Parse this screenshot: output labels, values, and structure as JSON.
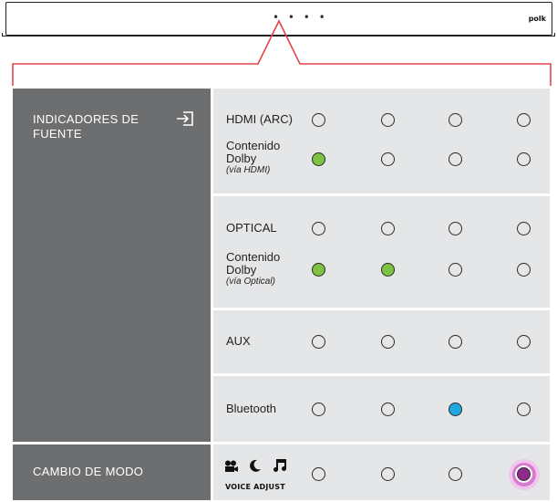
{
  "soundbar": {
    "brand": "polk",
    "indicator_dots": "• • • •"
  },
  "source_indicators": {
    "title": "INDICADORES DE FUENTE",
    "icon": "input-arrow-icon",
    "rows": [
      {
        "id": "hdmi-arc",
        "label": "HDMI (ARC)",
        "sub": "",
        "leds": [
          "off",
          "off",
          "off",
          "off"
        ]
      },
      {
        "id": "dolby-hdmi",
        "label": "Contenido Dolby",
        "sub": "(vía HDMI)",
        "leds": [
          "green",
          "off",
          "off",
          "off"
        ]
      },
      {
        "id": "optical",
        "label": "OPTICAL",
        "sub": "",
        "leds": [
          "off",
          "off",
          "off",
          "off"
        ]
      },
      {
        "id": "dolby-optical",
        "label": "Contenido Dolby",
        "sub": "(vía Optical)",
        "leds": [
          "green",
          "green",
          "off",
          "off"
        ]
      },
      {
        "id": "aux",
        "label": "AUX",
        "sub": "",
        "leds": [
          "off",
          "off",
          "off",
          "off"
        ]
      },
      {
        "id": "bluetooth",
        "label": "Bluetooth",
        "sub": "",
        "leds": [
          "off",
          "off",
          "blue",
          "off"
        ]
      }
    ]
  },
  "mode_change": {
    "title": "CAMBIO DE MODO",
    "icons": [
      "movie-camera-icon",
      "moon-icon",
      "music-note-icon"
    ],
    "voice_adjust": "VOICE ADJUST",
    "leds": [
      "off",
      "off",
      "off",
      "purple-pulse"
    ]
  },
  "colors": {
    "panel_gray": "#6d6e70",
    "row_gray": "#e5e6e7",
    "callout_red": "#e0454a",
    "led_green": "#7dc242",
    "led_blue": "#1ea7e1",
    "led_purple": "#8e2a8c"
  }
}
